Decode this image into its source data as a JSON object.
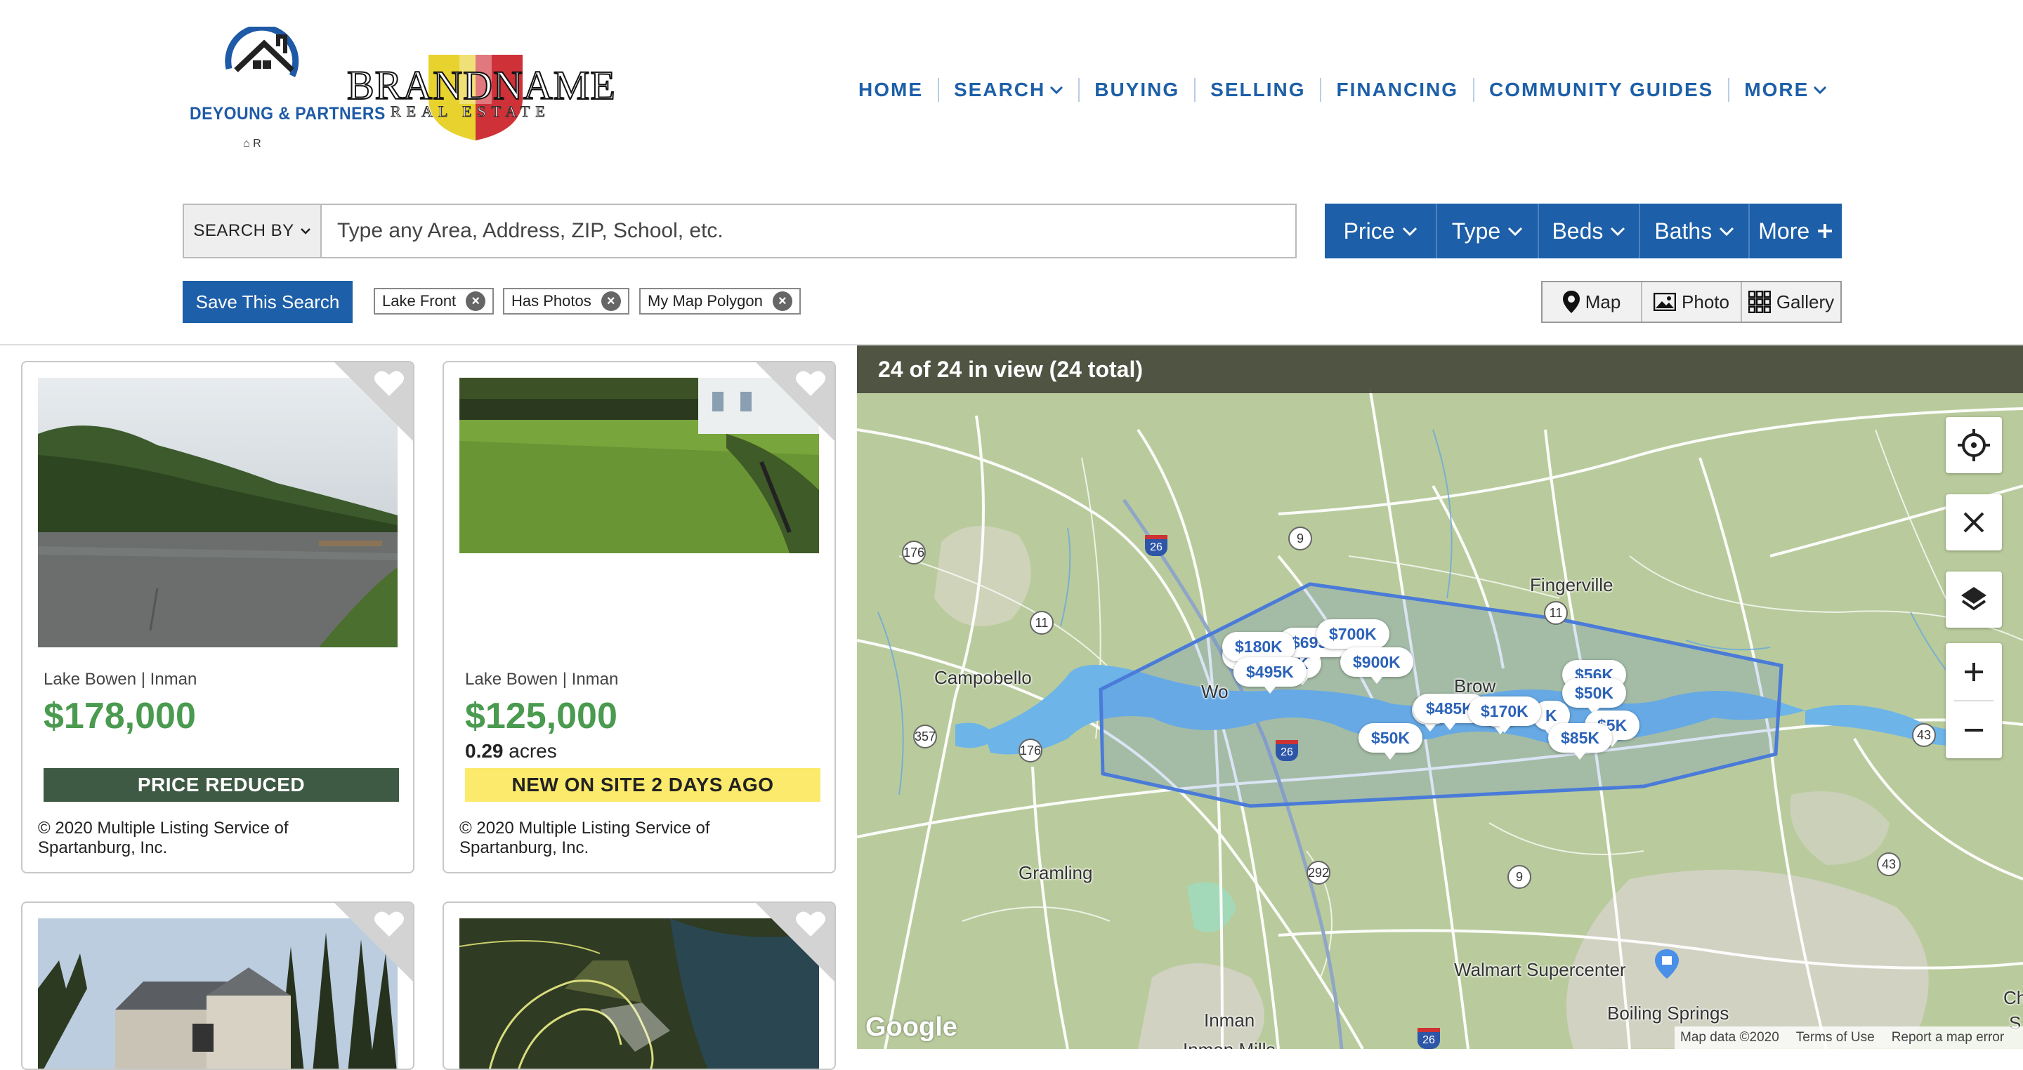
{
  "brand": {
    "partner_name": "DEYOUNG & PARTNERS",
    "partner_marks": "⌂ R",
    "brand_name": "BRANDNAME",
    "brand_sub": "REAL ESTATE"
  },
  "nav": {
    "items": [
      {
        "label": "HOME",
        "dropdown": false
      },
      {
        "label": "SEARCH",
        "dropdown": true
      },
      {
        "label": "BUYING",
        "dropdown": false
      },
      {
        "label": "SELLING",
        "dropdown": false
      },
      {
        "label": "FINANCING",
        "dropdown": false
      },
      {
        "label": "COMMUNITY GUIDES",
        "dropdown": false
      },
      {
        "label": "MORE",
        "dropdown": true
      }
    ]
  },
  "search": {
    "search_by_label": "SEARCH BY",
    "placeholder": "Type any Area, Address, ZIP, School, etc."
  },
  "filters": {
    "price": "Price",
    "type": "Type",
    "beds": "Beds",
    "baths": "Baths",
    "more": "More"
  },
  "save_search_label": "Save This Search",
  "chips": [
    "Lake Front",
    "Has Photos",
    "My Map Polygon"
  ],
  "view_toggle": {
    "map": "Map",
    "photo": "Photo",
    "gallery": "Gallery"
  },
  "listings": [
    {
      "location": "Lake Bowen | Inman",
      "price": "$178,000",
      "acres_value": "",
      "acres_unit": "",
      "banner": "PRICE REDUCED",
      "banner_bg": "#3f5a44",
      "banner_fg": "#ffffff",
      "copyright": "© 2020 Multiple Listing Service of Spartanburg, Inc."
    },
    {
      "location": "Lake Bowen | Inman",
      "price": "$125,000",
      "acres_value": "0.29",
      "acres_unit": "acres",
      "banner": "NEW ON SITE 2 DAYS AGO",
      "banner_bg": "#fbea6b",
      "banner_fg": "#222222",
      "copyright": "© 2020 Multiple Listing Service of Spartanburg, Inc."
    }
  ],
  "map": {
    "status": "24 of 24 in view (24 total)",
    "towns": [
      "Fingerville",
      "Campobello",
      "Gramling",
      "Inman",
      "Walmart Supercenter",
      "Boiling Springs",
      "Inman Mills",
      "Wo",
      "Brow",
      "Ch",
      "S"
    ],
    "routes": [
      "176",
      "26",
      "9",
      "11",
      "357",
      "292",
      "43"
    ],
    "price_pins": [
      "$180K",
      "$695K",
      "$700K",
      "$900K",
      "$495K",
      "$485K",
      "$170K",
      "$56K",
      "$50K",
      "$85K",
      "$50K",
      "$5K",
      "K"
    ],
    "google_logo": "Google",
    "footer": {
      "data": "Map data ©2020",
      "terms": "Terms of Use",
      "report": "Report a map error"
    }
  },
  "colors": {
    "accent": "#1d5fa8",
    "price_green": "#4a9a4f",
    "polygon": "#4a7bd8"
  }
}
